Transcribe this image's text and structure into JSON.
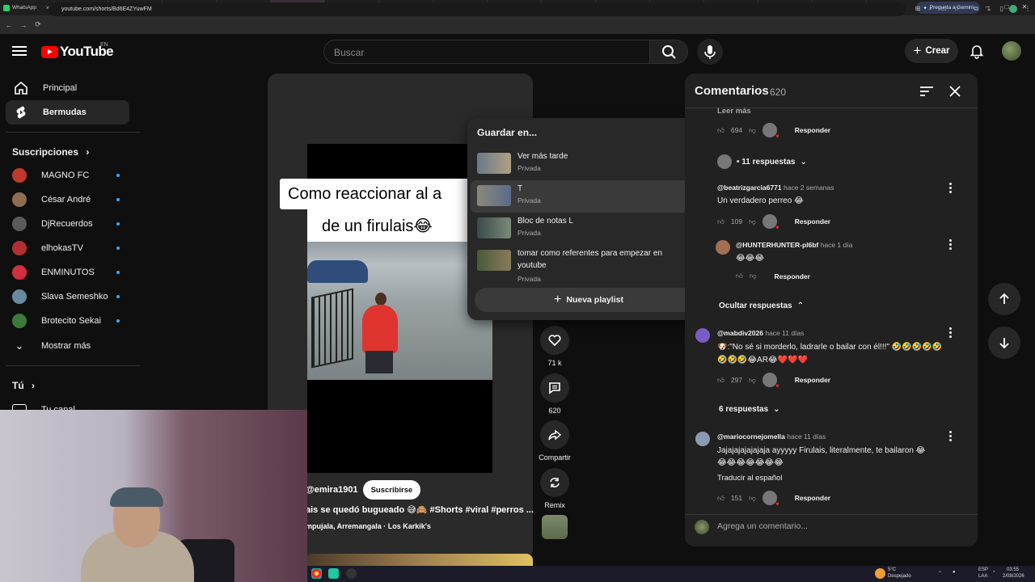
{
  "browser": {
    "tabs": [
      {
        "label": "WhatsApp",
        "color": "#25d366"
      },
      {
        "label": "Lien_Sorti",
        "color": "#1dbf4a"
      },
      {
        "label": "Stream - Ki",
        "color": "#1dbf4a"
      },
      {
        "label": "¿Ferrari",
        "color": "#ff2d2d"
      },
      {
        "label": "barcelo",
        "color": "#ff2d2d"
      },
      {
        "label": "El firuli",
        "color": "#ff2d2d"
      },
      {
        "label": "Película Du",
        "color": "#4a90e2"
      },
      {
        "label": "Ver Anime",
        "color": "#f5a623"
      },
      {
        "label": "Inicio | Ver",
        "color": "#888888"
      },
      {
        "label": "Rakudai",
        "color": "#e84a8a"
      },
      {
        "label": "Bai Ri Ch",
        "color": "#e84a8a"
      },
      {
        "label": "Historial",
        "color": "#aaaaaa"
      },
      {
        "label": "Koko wa C",
        "color": "#f5a623"
      },
      {
        "label": "Otome Ga",
        "color": "#f5a623"
      },
      {
        "label": "Tsuihou se",
        "color": "#f5a623"
      },
      {
        "label": "Rakudai Ki",
        "color": "#f5a623"
      }
    ],
    "active_tab_index": 5,
    "gemini_label": "Pregunta a Gemini",
    "url": "youtube.com/shorts/Bd6E4ZYuwFM"
  },
  "header": {
    "logo_text": "YouTube",
    "country": "EN",
    "search_placeholder": "Buscar",
    "create_label": "Crear"
  },
  "sidebar": {
    "main": [
      {
        "label": "Principal",
        "icon": "home-icon"
      },
      {
        "label": "Bermudas",
        "icon": "shorts-icon",
        "active": true
      }
    ],
    "subscriptions_heading": "Suscripciones",
    "subscriptions": [
      {
        "label": "MAGNO FC",
        "color": "#c0392b"
      },
      {
        "label": "César André",
        "color": "#8e6e53"
      },
      {
        "label": "DjRecuerdos",
        "color": "#5a5a5a"
      },
      {
        "label": "elhokasTV",
        "color": "#b03030"
      },
      {
        "label": "ENMINUTOS",
        "color": "#d03040"
      },
      {
        "label": "Slava Semeshko",
        "color": "#6a8aa0"
      },
      {
        "label": "Brotecito Sekai",
        "color": "#3a7a3a"
      }
    ],
    "show_more": "Mostrar más",
    "you_heading": "Tú",
    "your_channel": "Tu canal"
  },
  "short": {
    "caption_line1": "Como reaccionar al a",
    "caption_line2": "de un firulais😂",
    "channel": "@emira1901",
    "subscribe_label": "Suscribirse",
    "title": "ais se quedó bugueado 😅🙈 #Shorts #viral #perros ...",
    "music": "mpujala, Arremangala · Los Karkik's"
  },
  "actions": {
    "likes": "71 k",
    "comments": "620",
    "share": "Compartir",
    "remix": "Remix"
  },
  "save_menu": {
    "title": "Guardar en...",
    "playlists": [
      {
        "name": "Ver más tarde",
        "privacy": "Privada"
      },
      {
        "name": "T",
        "privacy": "Privada"
      },
      {
        "name": "Bloc de notas L",
        "privacy": "Privada"
      },
      {
        "name": "tomar como referentes para empezar en youtube",
        "privacy": "Privada"
      }
    ],
    "new_playlist": "Nueva playlist"
  },
  "comments": {
    "title": "Comentarios",
    "count": "620",
    "read_more": "Leer más",
    "top_likes": "694",
    "reply_label": "Responder",
    "replies_11": "• 11 respuestas",
    "c1_author": "@beatrizgarcia6771",
    "c1_time": "hace 2 semanas",
    "c1_text": "Un verdadero perreo 😂",
    "c1_likes": "109",
    "r1_author": "@HUNTERHUNTER-pl6bf",
    "r1_time": "hace 1 día",
    "r1_text": "😂😂😂",
    "hide_replies": "Ocultar respuestas",
    "c2_author": "@mabdiv2026",
    "c2_time": "hace 11 días",
    "c2_text_line1": "🐶:\"No sé si morderlo, ladrarle o bailar con él!!!\" 🤣🤣🤣🤣🤣",
    "c2_text_line2": "🤣🤣🤣😂AR😂❤️❤️❤️",
    "c2_likes": "297",
    "replies_6": "6 respuestas",
    "c3_author": "@mariocornejomella",
    "c3_time": "hace 11 días",
    "c3_text_line1": "Jajajajajajajaja  ayyyyy Firulais, literalmente, te bailaron  😂",
    "c3_text_line2": "😂😂😂😂😂😂😂",
    "translate": "Traducir al español",
    "c3_likes": "151",
    "add_placeholder": "Agrega un comentario..."
  },
  "taskbar": {
    "weather_temp": "5°C",
    "weather_desc": "Despejado",
    "lang": "ESP",
    "lang2": "LAA",
    "time": "03:55",
    "date": "2/08/2026"
  }
}
